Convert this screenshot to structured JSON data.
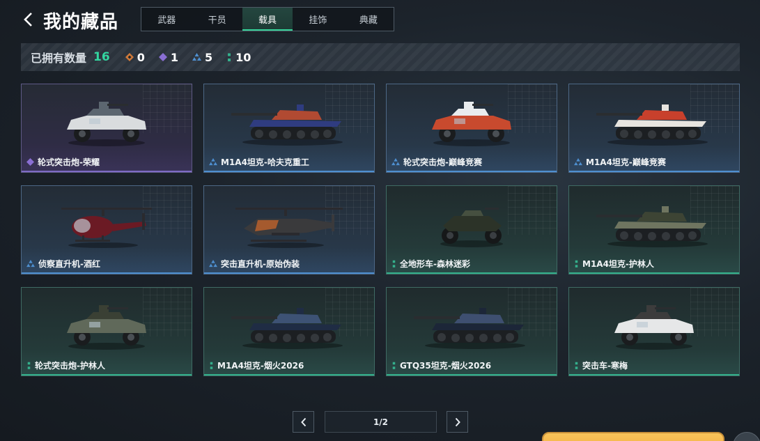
{
  "header": {
    "title": "我的藏品"
  },
  "tabs": [
    {
      "label": "武器",
      "active": false
    },
    {
      "label": "干员",
      "active": false
    },
    {
      "label": "载具",
      "active": true
    },
    {
      "label": "挂饰",
      "active": false
    },
    {
      "label": "典藏",
      "active": false
    }
  ],
  "stats": {
    "label": "已拥有数量",
    "total": "16",
    "legendary": "0",
    "epic": "1",
    "rare": "5",
    "common": "10"
  },
  "colors": {
    "accent": "#36d39a",
    "legendary": "#d07a3a",
    "epic": "#8a6fd4",
    "rare": "#4e8fd0",
    "common": "#34b08c"
  },
  "items": [
    {
      "name": "轮式突击炮-荣耀",
      "rarity": "epic",
      "vehicle": "armored-car"
    },
    {
      "name": "M1A4坦克-哈夫克重工",
      "rarity": "rare",
      "vehicle": "tank"
    },
    {
      "name": "轮式突击炮-巅峰竞赛",
      "rarity": "rare",
      "vehicle": "armored-car"
    },
    {
      "name": "M1A4坦克-巅峰竞赛",
      "rarity": "rare",
      "vehicle": "tank"
    },
    {
      "name": "侦察直升机-酒红",
      "rarity": "rare",
      "vehicle": "helicopter"
    },
    {
      "name": "突击直升机-原始伪装",
      "rarity": "rare",
      "vehicle": "attack-helicopter"
    },
    {
      "name": "全地形车-森林迷彩",
      "rarity": "common",
      "vehicle": "atv"
    },
    {
      "name": "M1A4坦克-护林人",
      "rarity": "common",
      "vehicle": "tank"
    },
    {
      "name": "轮式突击炮-护林人",
      "rarity": "common",
      "vehicle": "armored-car"
    },
    {
      "name": "M1A4坦克-烟火2026",
      "rarity": "common",
      "vehicle": "tank"
    },
    {
      "name": "GTQ35坦克-烟火2026",
      "rarity": "common",
      "vehicle": "tank"
    },
    {
      "name": "突击车-寒梅",
      "rarity": "common",
      "vehicle": "armored-car"
    }
  ],
  "pagination": {
    "display": "1/2"
  }
}
